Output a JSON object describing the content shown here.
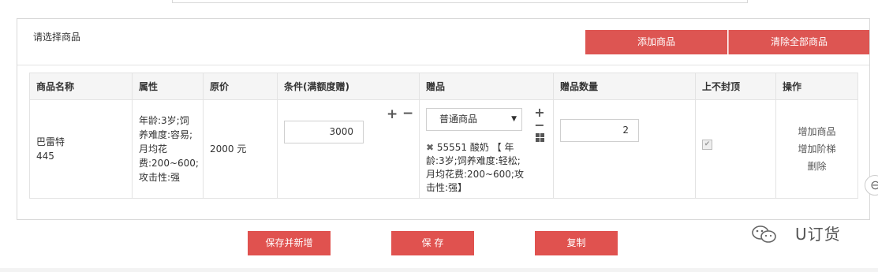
{
  "panel": {
    "title": "请选择商品",
    "add_goods_label": "添加商品",
    "clear_all_label": "清除全部商品"
  },
  "table": {
    "headers": [
      "商品名称",
      "属性",
      "原价",
      "条件(满额度赠)",
      "赠品",
      "赠品数量",
      "上不封顶",
      "操作"
    ],
    "row": {
      "name": "巴雷特",
      "code": "445",
      "attributes": "年龄:3岁;饲养难度:容易;月均花费:200~600;攻击性:强",
      "price": "2000 元",
      "condition_value": "3000",
      "gift_select": "普通商品",
      "gift_detail": "55551 酸奶 【 年龄:3岁;饲养难度:轻松;月均花费:200~600;攻击性:强】",
      "gift_qty": "2",
      "no_cap_checked": true,
      "actions": [
        "增加商品",
        "增加阶梯",
        "删除"
      ]
    }
  },
  "buttons": {
    "save_new": "保存并新增",
    "save": "保 存",
    "copy": "复制"
  },
  "watermark": {
    "text": "U订货"
  },
  "colors": {
    "accent": "#dd5552",
    "header_bg": "#f5f5f5",
    "border": "#e3e3e3"
  },
  "icons": {
    "plus": "+",
    "minus": "−",
    "remove": "✖",
    "caret": "▼",
    "check": "✔",
    "side_handle": "⊖"
  }
}
